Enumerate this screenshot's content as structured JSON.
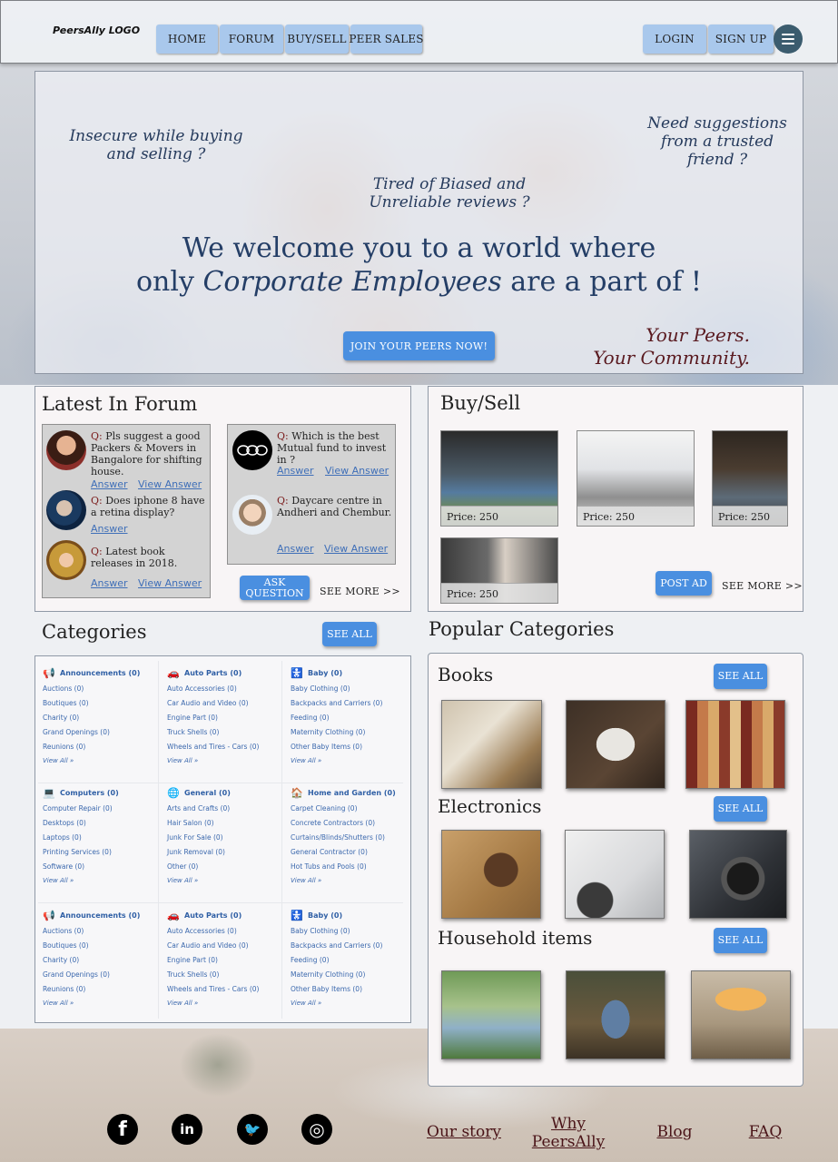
{
  "header": {
    "logo": "PeersAlly LOGO",
    "nav": [
      "HOME",
      "FORUM",
      "BUY/SELL",
      "PEER SALES"
    ],
    "login": "LOGIN",
    "signup": "SIGN UP"
  },
  "hero": {
    "q1": "Insecure while buying and selling ?",
    "q2": "Tired of Biased and Unreliable reviews ?",
    "q3": "Need suggestions from a trusted friend  ?",
    "welcome_line1": "We welcome you to a world where",
    "welcome_line2_pre": "only ",
    "welcome_line2_em": "Corporate Employees",
    "welcome_line2_post": " are a part of !",
    "cta": "JOIN YOUR PEERS NOW!",
    "tagline1": "Your Peers.",
    "tagline2": "Your Community."
  },
  "forum": {
    "title": "Latest In Forum",
    "left": [
      {
        "prefix": "Q:",
        "text": "Pls suggest a good Packers & Movers in Bangalore for shifting house.",
        "answer": "Answer",
        "view": "View Answer"
      },
      {
        "prefix": "Q:",
        "text": "Does iphone 8 have a retina display?",
        "answer": "Answer",
        "view": ""
      },
      {
        "prefix": "Q:",
        "text": "Latest book releases in 2018.",
        "answer": "Answer",
        "view": "View Answer"
      }
    ],
    "right": [
      {
        "prefix": "Q:",
        "text": "Which is the best Mutual fund to invest in ?",
        "answer": "Answer",
        "view": "View Answer"
      },
      {
        "prefix": "Q:",
        "text": "Daycare centre in Andheri and Chembur.",
        "answer": "Answer",
        "view": "View Answer"
      }
    ],
    "ask_line1": "ASK",
    "ask_line2": "QUESTION",
    "see_more": "SEE MORE >>"
  },
  "buysell": {
    "title": "Buy/Sell",
    "items": [
      {
        "price": "Price: 250"
      },
      {
        "price": "Price: 250"
      },
      {
        "price": "Price: 250"
      },
      {
        "price": "Price: 250"
      }
    ],
    "post_ad": "POST AD",
    "see_more": "SEE MORE >>"
  },
  "categories": {
    "title": "Categories",
    "see_all": "SEE ALL",
    "view_all": "View All »",
    "rows": [
      [
        {
          "icon": "megaphone-icon",
          "glyph": "📢",
          "name": "Announcements (0)",
          "items": [
            "Auctions (0)",
            "Boutiques (0)",
            "Charity (0)",
            "Grand Openings (0)",
            "Reunions (0)"
          ]
        },
        {
          "icon": "car-icon",
          "glyph": "🚗",
          "name": "Auto Parts (0)",
          "items": [
            "Auto Accessories (0)",
            "Car Audio and Video (0)",
            "Engine Part (0)",
            "Truck Shells (0)",
            "Wheels and Tires - Cars (0)"
          ]
        },
        {
          "icon": "baby-icon",
          "glyph": "🚼",
          "name": "Baby (0)",
          "items": [
            "Baby Clothing (0)",
            "Backpacks and Carriers (0)",
            "Feeding (0)",
            "Maternity Clothing (0)",
            "Other Baby Items (0)"
          ]
        }
      ],
      [
        {
          "icon": "laptop-icon",
          "glyph": "💻",
          "name": "Computers (0)",
          "items": [
            "Computer Repair (0)",
            "Desktops (0)",
            "Laptops (0)",
            "Printing Services (0)",
            "Software (0)"
          ]
        },
        {
          "icon": "globe-icon",
          "glyph": "🌐",
          "name": "General (0)",
          "items": [
            "Arts and Crafts (0)",
            "Hair Salon (0)",
            "Junk For Sale (0)",
            "Junk Removal (0)",
            "Other (0)"
          ]
        },
        {
          "icon": "home-icon",
          "glyph": "🏠",
          "name": "Home and Garden (0)",
          "items": [
            "Carpet Cleaning (0)",
            "Concrete Contractors (0)",
            "Curtains/Blinds/Shutters (0)",
            "General Contractor (0)",
            "Hot Tubs and Pools (0)"
          ]
        }
      ],
      [
        {
          "icon": "megaphone-icon",
          "glyph": "📢",
          "name": "Announcements (0)",
          "items": [
            "Auctions (0)",
            "Boutiques (0)",
            "Charity (0)",
            "Grand Openings (0)",
            "Reunions (0)"
          ]
        },
        {
          "icon": "car-icon",
          "glyph": "🚗",
          "name": "Auto Parts (0)",
          "items": [
            "Auto Accessories (0)",
            "Car Audio and Video (0)",
            "Engine Part (0)",
            "Truck Shells (0)",
            "Wheels and Tires - Cars (0)"
          ]
        },
        {
          "icon": "baby-icon",
          "glyph": "🚼",
          "name": "Baby (0)",
          "items": [
            "Baby Clothing (0)",
            "Backpacks and Carriers (0)",
            "Feeding (0)",
            "Maternity Clothing (0)",
            "Other Baby Items (0)"
          ]
        }
      ]
    ]
  },
  "popular": {
    "title": "Popular Categories",
    "groups": [
      {
        "name": "Books",
        "see_all": "SEE ALL"
      },
      {
        "name": "Electronics",
        "see_all": "SEE ALL"
      },
      {
        "name": "Household items",
        "see_all": "SEE ALL"
      }
    ]
  },
  "footer": {
    "social": [
      {
        "icon": "facebook-icon",
        "glyph": "f"
      },
      {
        "icon": "linkedin-icon",
        "glyph": "in"
      },
      {
        "icon": "twitter-icon",
        "glyph": "🐦"
      },
      {
        "icon": "instagram-icon",
        "glyph": "◎"
      }
    ],
    "links": [
      "Our story",
      "Why PeersAlly",
      "Blog",
      "FAQ"
    ]
  }
}
